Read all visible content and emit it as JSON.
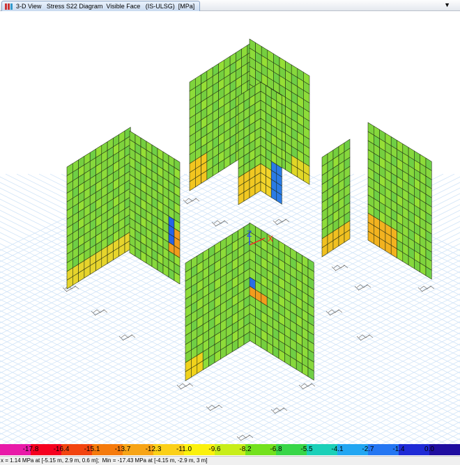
{
  "window": {
    "tab_title": "3-D View   Stress S22 Diagram  Visible Face   (IS-ULSG)  [MPa]",
    "dropdown_icon": "chevron-down-icon"
  },
  "axes": {
    "x": "X",
    "z": "Z"
  },
  "legend": {
    "ticks": [
      "-17.8",
      "-16.4",
      "-15.1",
      "-13.7",
      "-12.3",
      "-11.0",
      "-9.6",
      "-8.2",
      "-6.8",
      "-5.5",
      "-4.1",
      "-2.7",
      "-1.4",
      "0.0"
    ],
    "colors": [
      "#e81aa8",
      "#f5001f",
      "#f24410",
      "#f57a0c",
      "#f7a416",
      "#fbd018",
      "#fbf10d",
      "#c8ee1a",
      "#73e11d",
      "#38d648",
      "#1bd0b8",
      "#22a6f2",
      "#2476f2",
      "#1f2bd6",
      "#200ea0"
    ]
  },
  "status": {
    "text": "x = 1.14 MPa at [-5.15 m, 2.9 m, 0.6 m];  Min = -17.43 MPa at [-4.15 m, -2.9 m, 3 m]"
  },
  "colors": {
    "mesh_green": "#7ed33d",
    "mesh_line": "#1e2a12",
    "grid": "#cfe2f6",
    "axis_x": "#ff2020",
    "axis_z": "#2040ff"
  }
}
